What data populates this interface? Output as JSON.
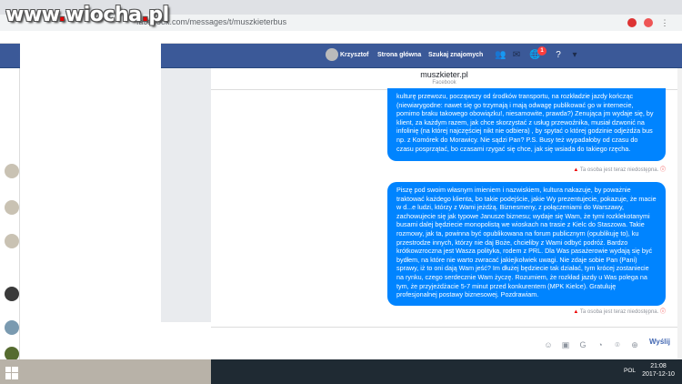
{
  "browser": {
    "url": "facebook.com/messages/t/muszkieterbus",
    "watermark_site": "www",
    "watermark_brand": "wiocha",
    "watermark_tld": "pl"
  },
  "fb_nav": {
    "user": "Krzysztof",
    "home": "Strona główna",
    "find_friends": "Szukaj znajomych",
    "notif_count": "1"
  },
  "conversation": {
    "title": "muszkieter.pl",
    "subtitle": "Facebook"
  },
  "messages": [
    {
      "text": "kulturę przewozu, począwszy od środków transportu, na rozkładzie jazdy kończąc (niewiarygodne: nawet się go trzymają i mają odwagę publikować go w internecie, pomimo braku takowego obowiązku!, niesamowite, prawda?) Zenująca jm wydaje się, by klient, za każdym razem, jak chce skorzystać z usług przewoźnika, musiał dzwonić na infolinię (na której najczęściej nikt nie odbiera) , by spytać o której godzinie odjeżdża bus np. z Komórek do Morawicy. Nie sądzi Pan? P.S. Busy też wypadałoby od czasu do czasu posprzątać, bo czasami rzygać się chce, jak się wsiada do takiego rzęcha.",
      "status": "Ta osoba jest teraz niedostępna."
    },
    {
      "text": "Piszę pod swoim własnym imieniem i nazwiskiem, kultura nakazuje, by poważnie traktować każdego klienta, bo takie podejście, jakie Wy prezentujecie, pokazuje, że macie w d...e ludzi, którzy z Wami jeżdżą. Biznesmeny, z połączeniami do Warszawy, zachowujecie się jak typowe Janusze biznesu; wydaje się Wam, że tymi rozklekotanymi busami dalej będziecie monopolistą we wioskach na trasie z Kielc do Staszowa. Takie rozmowy, jak ta, powinna być opublikowana na forum publicznym (opublikuję to), ku przestrodze innych, którzy nie daj Boże, chcieliby z Wami odbyć podróż. Bardzo krótkowzroczna jest Wasza polityka, rodem z PRL. Dla Was pasażerowie wydają się być bydłem, na które nie warto zwracać jakiejkolwiek uwagi. Nie zdaje sobie Pan (Pani) sprawy, iż to oni dają Wam jeść? Im dłużej będziecie tak działać, tym krócej zostaniecie na rynku, czego serdecznie Wam życzę. Rozumiem, że rozkład jazdy u Was polega na tym, że przyjeżdżacie 5-7 minut przed konkurentem (MPK Kielce). Gratuluję profesjonalnej postawy biznesowej. Pozdrawiam.",
      "status": "Ta osoba jest teraz niedostępna."
    }
  ],
  "composer": {
    "send_label": "Wyślij"
  },
  "taskbar": {
    "lang": "POL",
    "time": "21:08",
    "date": "2017-12-10"
  },
  "colors": {
    "fb_blue": "#3b5998",
    "bubble": "#0084ff"
  }
}
